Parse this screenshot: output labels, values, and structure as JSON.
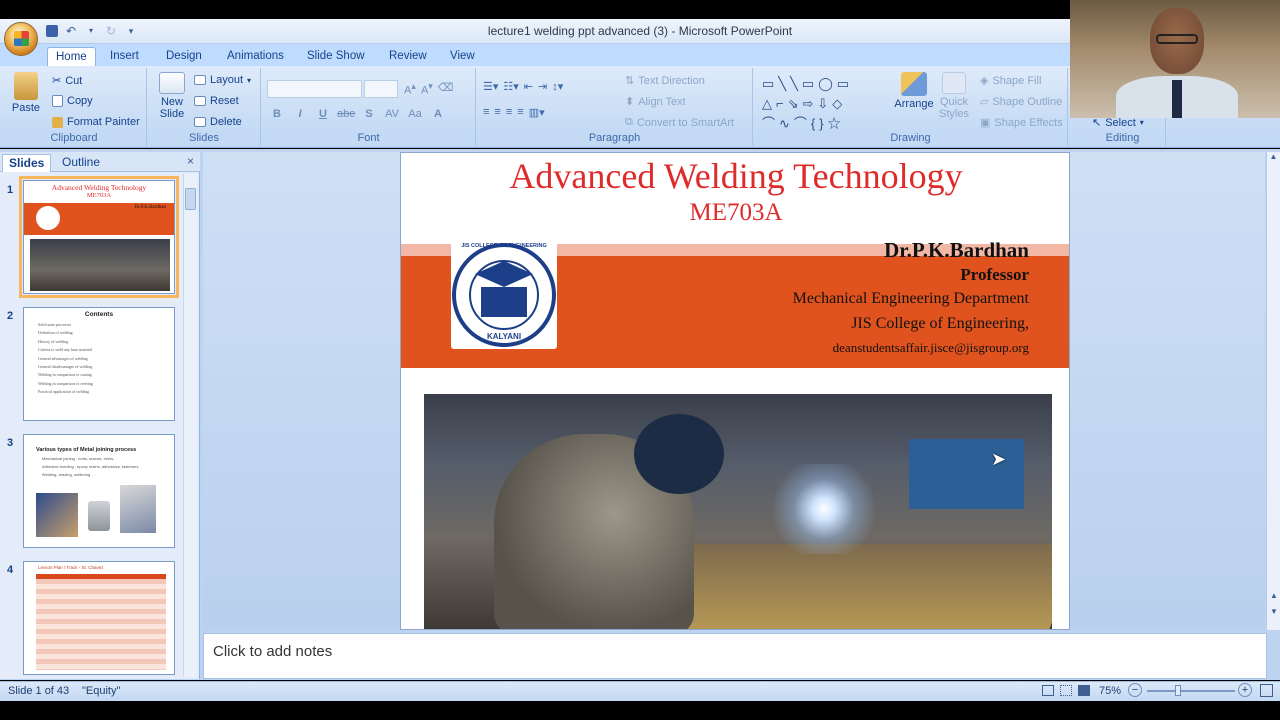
{
  "window": {
    "title": "lecture1 welding ppt  advanced (3) - Microsoft PowerPoint"
  },
  "tabs": [
    "Home",
    "Insert",
    "Design",
    "Animations",
    "Slide Show",
    "Review",
    "View"
  ],
  "ribbon": {
    "clipboard": {
      "label": "Clipboard",
      "paste": "Paste",
      "cut": "Cut",
      "copy": "Copy",
      "format_painter": "Format Painter"
    },
    "slides": {
      "label": "Slides",
      "new_slide_1": "New",
      "new_slide_2": "Slide",
      "layout": "Layout",
      "reset": "Reset",
      "delete": "Delete"
    },
    "font": {
      "label": "Font",
      "bold": "B",
      "italic": "I",
      "underline": "U",
      "strike": "abe",
      "shadow": "S",
      "spacing": "AV",
      "case": "Aa",
      "color": "A"
    },
    "paragraph": {
      "label": "Paragraph",
      "text_direction": "Text Direction",
      "align_text": "Align Text",
      "convert": "Convert to SmartArt"
    },
    "drawing": {
      "label": "Drawing",
      "arrange": "Arrange",
      "quick_styles_1": "Quick",
      "quick_styles_2": "Styles",
      "shape_fill": "Shape Fill",
      "shape_outline": "Shape Outline",
      "shape_effects": "Shape Effects"
    },
    "editing": {
      "label": "Editing",
      "select": "Select"
    }
  },
  "pane": {
    "tab_slides": "Slides",
    "tab_outline": "Outline",
    "close": "×"
  },
  "thumbnails": [
    {
      "num": "1",
      "title": "Advanced Welding Technology",
      "sub": "ME703A",
      "author": "Dr.P.K.Bardhan"
    },
    {
      "num": "2",
      "title": "Contents",
      "items": [
        "Solid state processes",
        "Definition of welding",
        "History of welding",
        "Criteria to weld any base material",
        "General advantages of welding",
        "General disadvantages of welding",
        "Welding in comparison to casting",
        "Welding in comparison to riveting",
        "Practical application of welding"
      ]
    },
    {
      "num": "3",
      "title": "Various types of Metal joining process",
      "items": [
        "Mechanical joining : bolts, screws, rivets,",
        "Adhesive bonding : epoxy resins, adhesives, fasteners",
        "Welding, brazing, soldering"
      ]
    },
    {
      "num": "4",
      "title": "Lesson Plan / Track - St. Chavez"
    }
  ],
  "slide": {
    "title": "Advanced Welding Technology",
    "code": "ME703A",
    "author": "Dr.P.K.Bardhan",
    "role": "Professor",
    "dept": "Mechanical Engineering Department",
    "college": "JIS College of Engineering,",
    "email": "deanstudentsaffair.jisce@jisgroup.org",
    "logo_text": "JIS COLLEGE OF ENGINEERING",
    "logo_city": "KALYANI"
  },
  "notes": {
    "placeholder": "Click to add notes"
  },
  "status": {
    "slide_info": "Slide 1 of 43",
    "theme": "\"Equity\"",
    "zoom": "75%"
  },
  "colors": {
    "accent": "#e0531e",
    "title_red": "#e02b2b",
    "ribbon_bg": "#c7dcf5"
  }
}
